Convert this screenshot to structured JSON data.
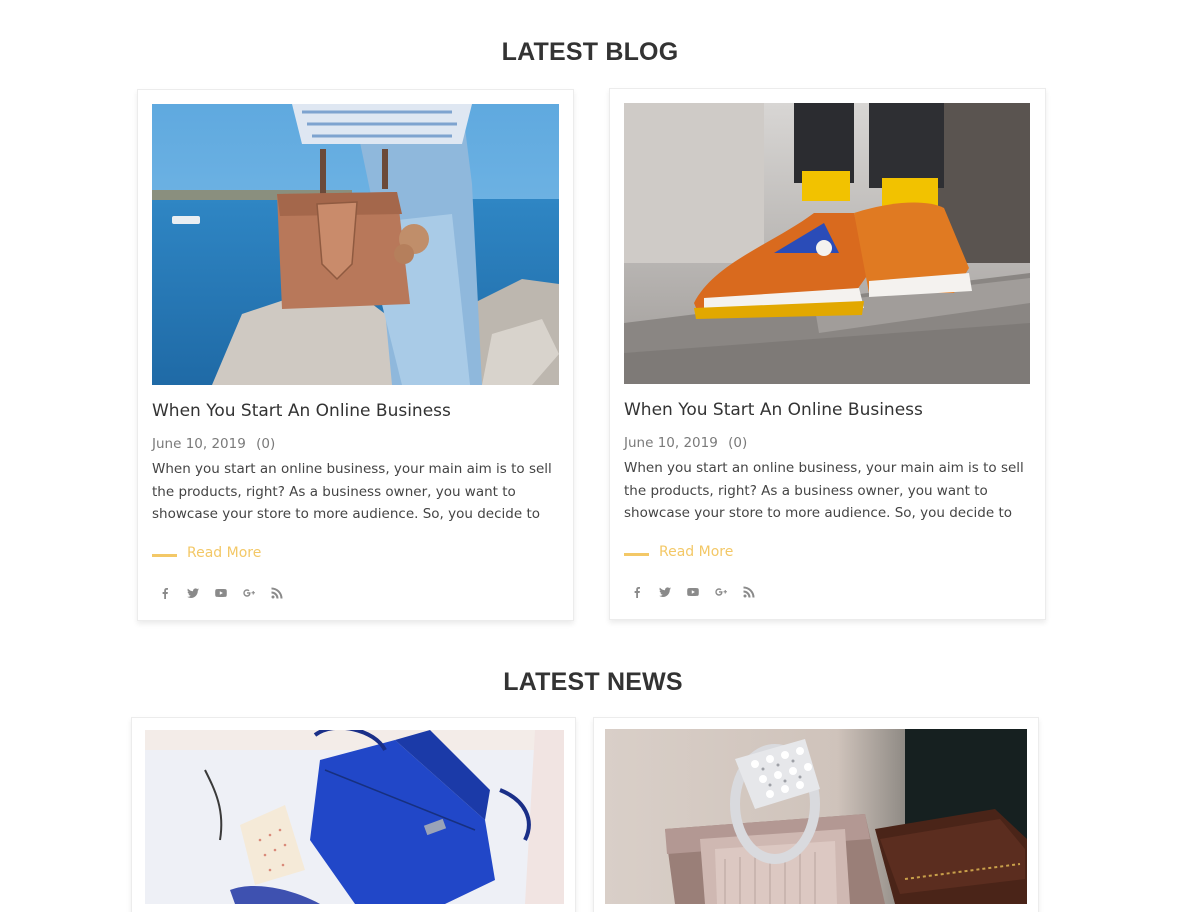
{
  "blog": {
    "title": "LATEST BLOG",
    "posts": [
      {
        "image": "woman-handbag-photo",
        "title": "When You Start An Online Business",
        "date": "June 10, 2019",
        "comments": "(0)",
        "excerpt": "When you start an online business, your main aim is to sell the products, right? As a business owner, you want to showcase your store to more audience. So, you decide to",
        "read_more": "Read More"
      },
      {
        "image": "sneakers-photo",
        "title": "When You Start An Online Business",
        "date": "June 10, 2019",
        "comments": "(0)",
        "excerpt": "When you start an online business, your main aim is to sell the products, right? As a business owner, you want to showcase your store to more audience. So, you decide to",
        "read_more": "Read More"
      }
    ],
    "social_icons": [
      "facebook-icon",
      "twitter-icon",
      "youtube-icon",
      "google-plus-icon",
      "rss-icon"
    ]
  },
  "news": {
    "title": "LATEST NEWS",
    "items": [
      {
        "image": "blue-backpack-photo"
      },
      {
        "image": "ring-box-photo"
      }
    ]
  },
  "colors": {
    "accent": "#f3c867",
    "heading": "#333333",
    "meta": "#7a7a7a",
    "icon": "#8a8a8a"
  }
}
